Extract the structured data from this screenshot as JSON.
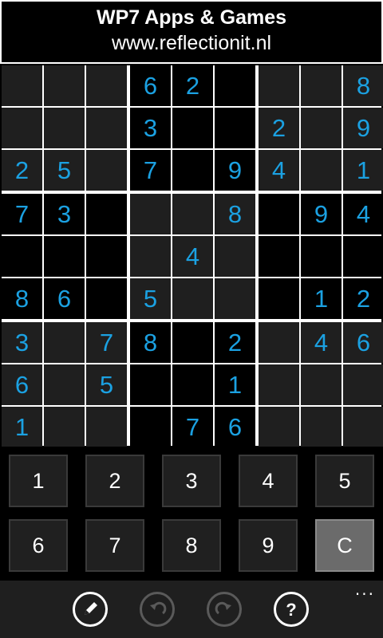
{
  "header": {
    "title": "WP7 Apps & Games",
    "url": "www.reflectionit.nl"
  },
  "grid": [
    [
      "",
      "",
      "",
      "6",
      "2",
      "",
      "",
      "",
      "8"
    ],
    [
      "",
      "",
      "",
      "3",
      "",
      "",
      "2",
      "",
      "9"
    ],
    [
      "2",
      "5",
      "",
      "7",
      "",
      "9",
      "4",
      "",
      "1"
    ],
    [
      "7",
      "3",
      "",
      "",
      "",
      "8",
      "",
      "9",
      "4"
    ],
    [
      "",
      "",
      "",
      "",
      "4",
      "",
      "",
      "",
      ""
    ],
    [
      "8",
      "6",
      "",
      "5",
      "",
      "",
      "",
      "1",
      "2"
    ],
    [
      "3",
      "",
      "7",
      "8",
      "",
      "2",
      "",
      "4",
      "6"
    ],
    [
      "6",
      "",
      "5",
      "",
      "",
      "1",
      "",
      "",
      ""
    ],
    [
      "1",
      "",
      "",
      "",
      "7",
      "6",
      "",
      "",
      ""
    ]
  ],
  "colors": {
    "digit": "#1ba1e2",
    "light_box": "#1f1f1f",
    "dark_box": "#000000",
    "grid_lines": "#ffffff"
  },
  "keypad": {
    "keys": [
      "1",
      "2",
      "3",
      "4",
      "5",
      "6",
      "7",
      "8",
      "9",
      "C"
    ]
  },
  "appbar": {
    "buttons": [
      {
        "icon": "pencil-icon",
        "enabled": true
      },
      {
        "icon": "undo-icon",
        "enabled": false
      },
      {
        "icon": "redo-icon",
        "enabled": false
      },
      {
        "icon": "help-icon",
        "enabled": true
      }
    ],
    "more_label": "..."
  }
}
